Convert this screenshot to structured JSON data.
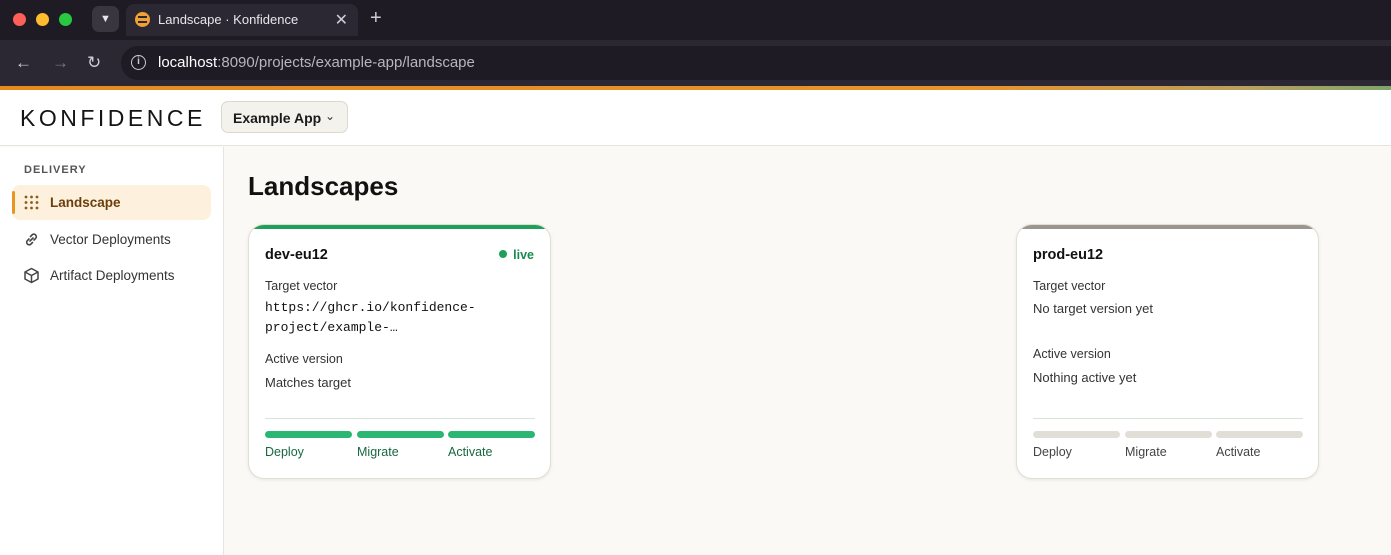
{
  "browser": {
    "tab_title": "Landscape · Konfidence",
    "url_host": "localhost",
    "url_rest": ":8090/projects/example-app/landscape"
  },
  "header": {
    "logo_text": "KONFIDENCE",
    "app_selector": "Example App"
  },
  "sidebar": {
    "section": "DELIVERY",
    "items": [
      {
        "label": "Landscape",
        "icon": "grid-dots-icon",
        "active": true
      },
      {
        "label": "Vector Deployments",
        "icon": "link-icon",
        "active": false
      },
      {
        "label": "Artifact Deployments",
        "icon": "box-icon",
        "active": false
      }
    ]
  },
  "main": {
    "title": "Landscapes",
    "cards": [
      {
        "name": "dev-eu12",
        "status": "live",
        "accent_color": "#1fa05a",
        "target_label": "Target vector",
        "target_value": "https://ghcr.io/konfidence-project/example-…",
        "active_label": "Active version",
        "active_value": "Matches target",
        "steps": [
          {
            "label": "Deploy",
            "done": true
          },
          {
            "label": "Migrate",
            "done": true
          },
          {
            "label": "Activate",
            "done": true
          }
        ]
      },
      {
        "name": "prod-eu12",
        "status": "",
        "accent_color": "#9a958d",
        "target_label": "Target vector",
        "target_value": "No target version yet",
        "active_label": "Active version",
        "active_value": "Nothing active yet",
        "steps": [
          {
            "label": "Deploy",
            "done": false
          },
          {
            "label": "Migrate",
            "done": false
          },
          {
            "label": "Activate",
            "done": false
          }
        ]
      }
    ]
  }
}
